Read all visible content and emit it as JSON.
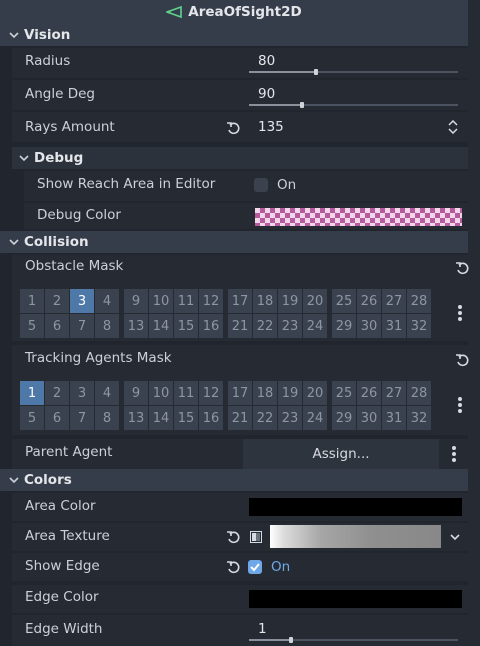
{
  "header": {
    "title": "AreaOfSight2D",
    "icon": "area-of-sight-node-icon",
    "icon_color": "#5fd38d"
  },
  "sections": {
    "vision": {
      "label": "Vision"
    },
    "debug": {
      "label": "Debug"
    },
    "collision": {
      "label": "Collision"
    },
    "colors": {
      "label": "Colors"
    }
  },
  "properties": {
    "radius": {
      "label": "Radius",
      "value": "80",
      "slider_fraction": 0.32
    },
    "angle_deg": {
      "label": "Angle Deg",
      "value": "90",
      "slider_fraction": 0.25
    },
    "rays_amount": {
      "label": "Rays Amount",
      "value": "135"
    },
    "show_reach": {
      "label": "Show Reach Area in Editor",
      "value": "On",
      "checked": true
    },
    "debug_color": {
      "label": "Debug Color",
      "value_color": "#b65a9e"
    },
    "obstacle_mask": {
      "label": "Obstacle Mask",
      "active_layers": [
        3
      ]
    },
    "tracking_mask": {
      "label": "Tracking Agents Mask",
      "active_layers": [
        1
      ]
    },
    "parent_agent": {
      "label": "Parent Agent",
      "button": "Assign..."
    },
    "area_color": {
      "label": "Area Color",
      "value_color": "#000000"
    },
    "area_texture": {
      "label": "Area Texture"
    },
    "show_edge": {
      "label": "Show Edge",
      "value": "On",
      "checked": true
    },
    "edge_color": {
      "label": "Edge Color",
      "value_color": "#000000"
    },
    "edge_width": {
      "label": "Edge Width",
      "value": "1",
      "slider_fraction": 0.2
    }
  },
  "layer_grid": {
    "row1": [
      "1",
      "2",
      "3",
      "4",
      "9",
      "10",
      "11",
      "12",
      "17",
      "18",
      "19",
      "20",
      "25",
      "26",
      "27",
      "28"
    ],
    "row2": [
      "5",
      "6",
      "7",
      "8",
      "13",
      "14",
      "15",
      "16",
      "21",
      "22",
      "23",
      "24",
      "29",
      "30",
      "31",
      "32"
    ]
  },
  "colors": {
    "accent": "#6ea8e8",
    "layer_on": "#4d78a8",
    "panel": "#21262e",
    "section": "#363d4a"
  }
}
